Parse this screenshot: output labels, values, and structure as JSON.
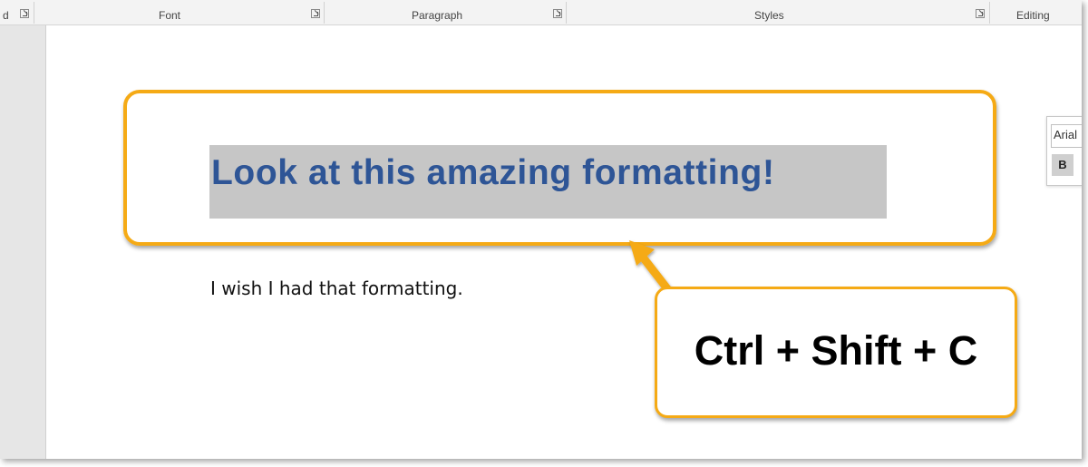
{
  "ribbon": {
    "groups": [
      {
        "label": "d"
      },
      {
        "label": "Font"
      },
      {
        "label": "Paragraph"
      },
      {
        "label": "Styles"
      },
      {
        "label": "Editing"
      }
    ]
  },
  "document": {
    "heading": "Look at this amazing formatting!",
    "body": "I wish I had that formatting."
  },
  "callout": {
    "text": "Ctrl + Shift + C"
  },
  "mini_toolbar": {
    "font_name": "Arial",
    "bold_label": "B"
  },
  "colors": {
    "accent": "#f5aa15",
    "heading_text": "#2e5596",
    "selection_highlight": "#c6c6c6"
  },
  "icons": {
    "dialog_launcher": "dialog-launcher-icon",
    "callout_pointer": "arrow-icon"
  }
}
